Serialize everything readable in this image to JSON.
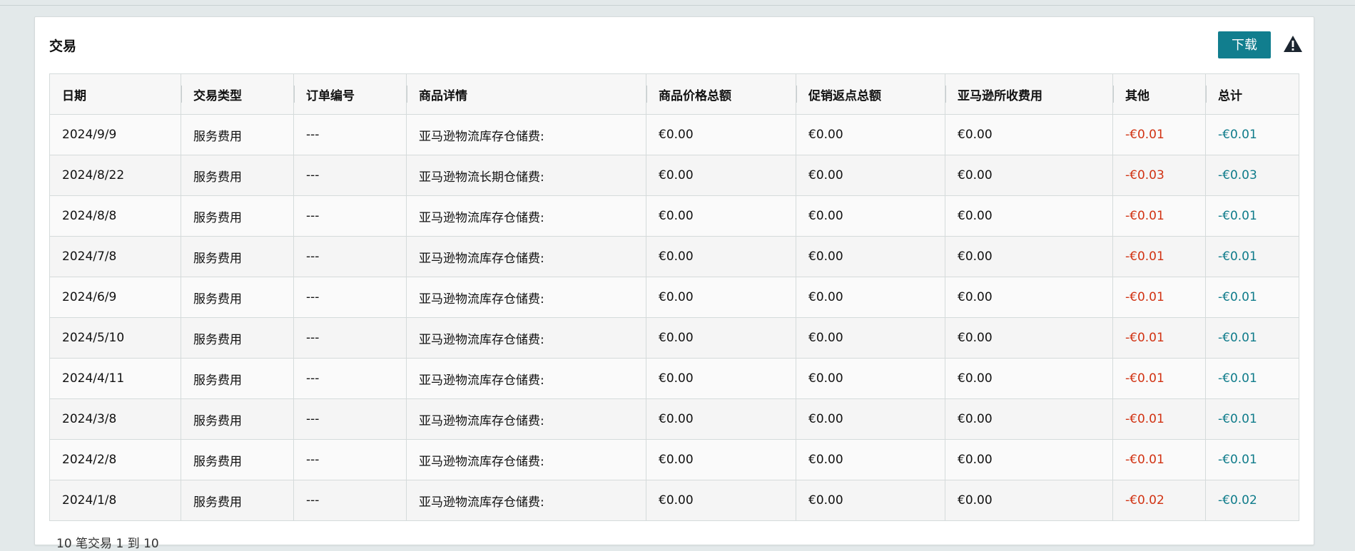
{
  "panel": {
    "title": "交易",
    "download_label": "下载",
    "warning_icon": "warning-triangle-icon"
  },
  "table": {
    "columns": [
      "日期",
      "交易类型",
      "订单编号",
      "商品详情",
      "商品价格总额",
      "促销返点总额",
      "亚马逊所收费用",
      "其他",
      "总计"
    ],
    "rows": [
      {
        "date": "2024/9/9",
        "type": "服务费用",
        "order": "---",
        "detail": "亚马逊物流库存仓储费:",
        "price": "€0.00",
        "promo": "€0.00",
        "fees": "€0.00",
        "other": "-€0.01",
        "total": "-€0.01"
      },
      {
        "date": "2024/8/22",
        "type": "服务费用",
        "order": "---",
        "detail": "亚马逊物流长期仓储费:",
        "price": "€0.00",
        "promo": "€0.00",
        "fees": "€0.00",
        "other": "-€0.03",
        "total": "-€0.03"
      },
      {
        "date": "2024/8/8",
        "type": "服务费用",
        "order": "---",
        "detail": "亚马逊物流库存仓储费:",
        "price": "€0.00",
        "promo": "€0.00",
        "fees": "€0.00",
        "other": "-€0.01",
        "total": "-€0.01"
      },
      {
        "date": "2024/7/8",
        "type": "服务费用",
        "order": "---",
        "detail": "亚马逊物流库存仓储费:",
        "price": "€0.00",
        "promo": "€0.00",
        "fees": "€0.00",
        "other": "-€0.01",
        "total": "-€0.01"
      },
      {
        "date": "2024/6/9",
        "type": "服务费用",
        "order": "---",
        "detail": "亚马逊物流库存仓储费:",
        "price": "€0.00",
        "promo": "€0.00",
        "fees": "€0.00",
        "other": "-€0.01",
        "total": "-€0.01"
      },
      {
        "date": "2024/5/10",
        "type": "服务费用",
        "order": "---",
        "detail": "亚马逊物流库存仓储费:",
        "price": "€0.00",
        "promo": "€0.00",
        "fees": "€0.00",
        "other": "-€0.01",
        "total": "-€0.01"
      },
      {
        "date": "2024/4/11",
        "type": "服务费用",
        "order": "---",
        "detail": "亚马逊物流库存仓储费:",
        "price": "€0.00",
        "promo": "€0.00",
        "fees": "€0.00",
        "other": "-€0.01",
        "total": "-€0.01"
      },
      {
        "date": "2024/3/8",
        "type": "服务费用",
        "order": "---",
        "detail": "亚马逊物流库存仓储费:",
        "price": "€0.00",
        "promo": "€0.00",
        "fees": "€0.00",
        "other": "-€0.01",
        "total": "-€0.01"
      },
      {
        "date": "2024/2/8",
        "type": "服务费用",
        "order": "---",
        "detail": "亚马逊物流库存仓储费:",
        "price": "€0.00",
        "promo": "€0.00",
        "fees": "€0.00",
        "other": "-€0.01",
        "total": "-€0.01"
      },
      {
        "date": "2024/1/8",
        "type": "服务费用",
        "order": "---",
        "detail": "亚马逊物流库存仓储费:",
        "price": "€0.00",
        "promo": "€0.00",
        "fees": "€0.00",
        "other": "-€0.02",
        "total": "-€0.02"
      }
    ]
  },
  "footer": {
    "summary": "10 笔交易 1 到 10"
  },
  "colors": {
    "accent": "#117e8e",
    "negative_other": "#d13212",
    "negative_total": "#0e7b8a",
    "background": "#e3e9ea"
  }
}
